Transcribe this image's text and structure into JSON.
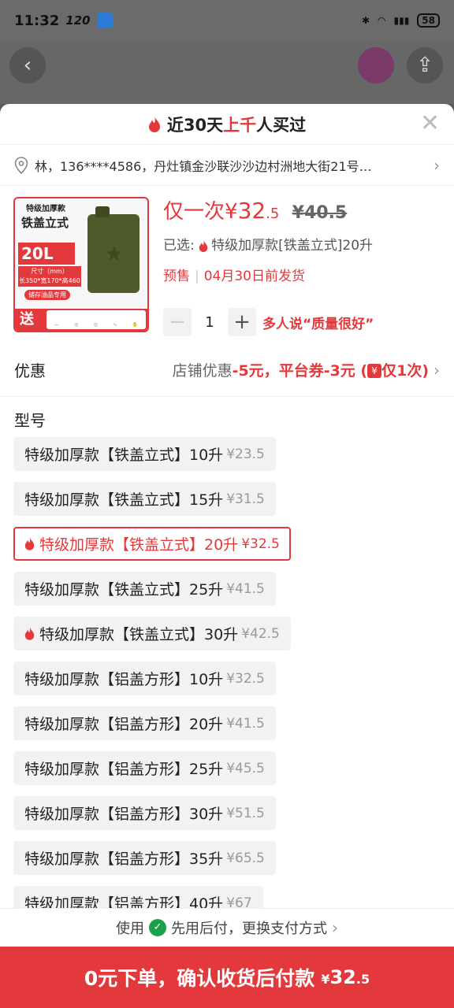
{
  "status": {
    "time": "11:32",
    "speed": "120",
    "battery": "58"
  },
  "header": {
    "pre": "近30天",
    "highlight": "上千",
    "post": "人买过",
    "close": "✕"
  },
  "address": {
    "text": "林，136****4586，丹灶镇金沙联沙沙边村洲地大街21号…"
  },
  "product": {
    "image_top": "特级加厚款",
    "image_title": "铁盖立式",
    "image_capacity": "20L",
    "image_size_label": "尺寸（mm）",
    "image_size": "长350*宽170*高460",
    "image_note": "储存油品专用",
    "image_gift": "送",
    "price_prefix": "仅一次",
    "price_currency": "¥",
    "price_int": "32",
    "price_dec": ".5",
    "old_price": "¥40.5",
    "selected_prefix": "已选:",
    "selected_value": "特级加厚款[铁盖立式]20升",
    "presale": "预售",
    "ship": "04月30日前发货",
    "qty": "1",
    "praise": "多人说“质量很好”"
  },
  "promo": {
    "label": "优惠",
    "shop": "店铺优惠",
    "shop_amt": "-5元，",
    "platform": "平台券-3元 (",
    "badge": "¥",
    "limit": "仅1次)"
  },
  "spec": {
    "title": "型号",
    "options": [
      {
        "name": "特级加厚款【铁盖立式】10升",
        "price": "¥23.5",
        "hot": false,
        "selected": false
      },
      {
        "name": "特级加厚款【铁盖立式】15升",
        "price": "¥31.5",
        "hot": false,
        "selected": false
      },
      {
        "name": "特级加厚款【铁盖立式】20升",
        "price": "¥32.5",
        "hot": true,
        "selected": true
      },
      {
        "name": "特级加厚款【铁盖立式】25升",
        "price": "¥41.5",
        "hot": false,
        "selected": false
      },
      {
        "name": "特级加厚款【铁盖立式】30升",
        "price": "¥42.5",
        "hot": true,
        "selected": false
      },
      {
        "name": "特级加厚款【铝盖方形】10升",
        "price": "¥32.5",
        "hot": false,
        "selected": false
      },
      {
        "name": "特级加厚款【铝盖方形】20升",
        "price": "¥41.5",
        "hot": false,
        "selected": false
      },
      {
        "name": "特级加厚款【铝盖方形】25升",
        "price": "¥45.5",
        "hot": false,
        "selected": false
      },
      {
        "name": "特级加厚款【铝盖方形】30升",
        "price": "¥51.5",
        "hot": false,
        "selected": false
      },
      {
        "name": "特级加厚款【铝盖方形】35升",
        "price": "¥65.5",
        "hot": false,
        "selected": false
      },
      {
        "name": "特级加厚款【铝盖方形】40升",
        "price": "¥67",
        "hot": false,
        "selected": false
      }
    ]
  },
  "payment": {
    "pre": "使用",
    "method": "先用后付，更换支付方式",
    "icon": "pay-later-icon"
  },
  "cta": {
    "label": "0元下单，确认收货后付款",
    "currency": "¥",
    "amount": "32",
    "dec": ".5"
  },
  "colors": {
    "accent": "#e4393c",
    "pay_green": "#1aa14a"
  }
}
